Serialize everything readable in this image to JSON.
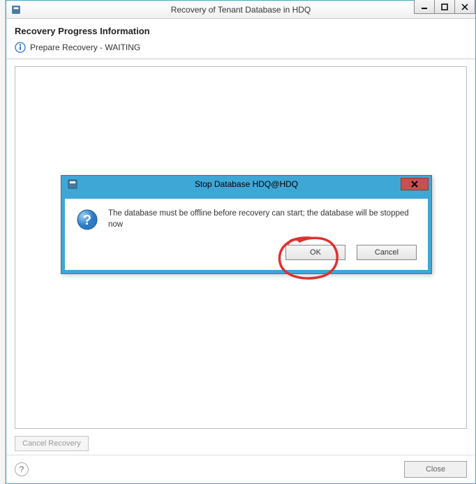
{
  "window": {
    "title": "Recovery of Tenant Database in HDQ",
    "heading": "Recovery Progress Information",
    "status_text": "Prepare Recovery - WAITING",
    "cancel_recovery_label": "Cancel Recovery",
    "close_label": "Close"
  },
  "dialog": {
    "title": "Stop Database HDQ@HDQ",
    "message": "The database must be offline before recovery can start; the database will be stopped now",
    "ok_label": "OK",
    "cancel_label": "Cancel"
  }
}
